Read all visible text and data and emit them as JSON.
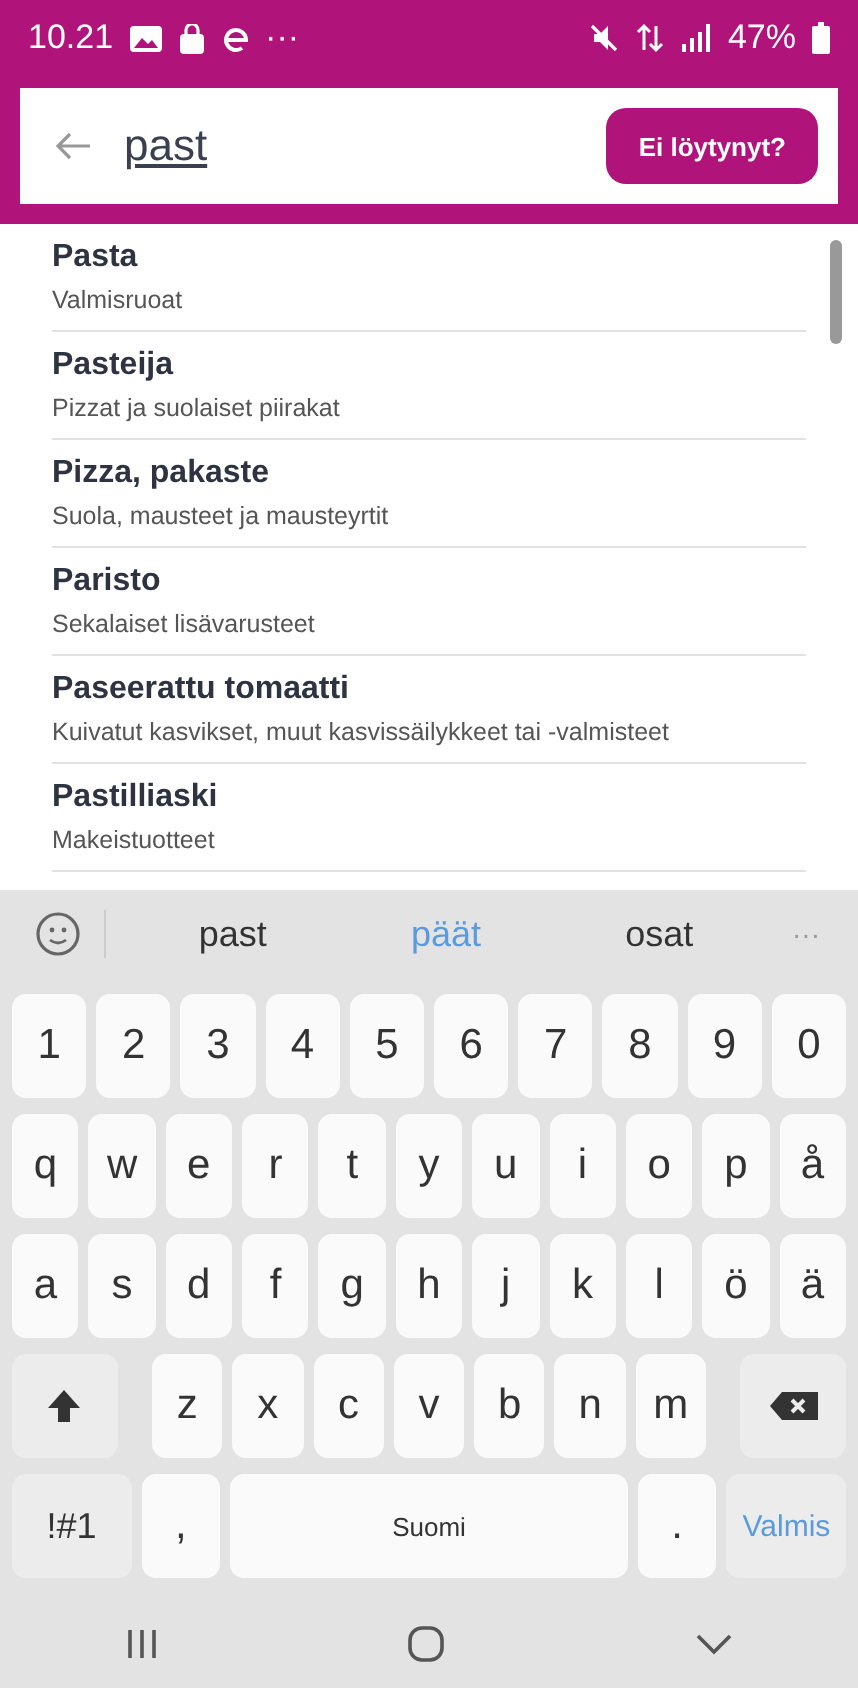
{
  "status_bar": {
    "time": "10.21",
    "more": "···",
    "battery": "47%"
  },
  "search": {
    "value": "past",
    "not_found_button": "Ei löytynyt?"
  },
  "results": [
    {
      "name": "Pasta",
      "category": "Valmisruoat"
    },
    {
      "name": "Pasteija",
      "category": "Pizzat ja suolaiset piirakat"
    },
    {
      "name": "Pizza, pakaste",
      "category": "Suola, mausteet ja mausteyrtit"
    },
    {
      "name": "Paristo",
      "category": "Sekalaiset lisävarusteet"
    },
    {
      "name": "Paseerattu tomaatti",
      "category": "Kuivatut kasvikset, muut kasvissäilykkeet tai -valmisteet"
    },
    {
      "name": "Pastilliaski",
      "category": "Makeistuotteet"
    }
  ],
  "keyboard": {
    "suggestions": [
      {
        "label": "past",
        "selected": false
      },
      {
        "label": "päät",
        "selected": true
      },
      {
        "label": "osat",
        "selected": false
      }
    ],
    "more": "···",
    "number_keys": [
      {
        "kind": "char",
        "label": "1"
      },
      {
        "kind": "char",
        "label": "2"
      },
      {
        "kind": "char",
        "label": "3"
      },
      {
        "kind": "char",
        "label": "4"
      },
      {
        "kind": "char",
        "label": "5"
      },
      {
        "kind": "char",
        "label": "6"
      },
      {
        "kind": "char",
        "label": "7"
      },
      {
        "kind": "char",
        "label": "8"
      },
      {
        "kind": "char",
        "label": "9"
      },
      {
        "kind": "char",
        "label": "0"
      }
    ],
    "top_letter_keys": [
      {
        "kind": "char",
        "label": "q"
      },
      {
        "kind": "char",
        "label": "w"
      },
      {
        "kind": "char",
        "label": "e"
      },
      {
        "kind": "char",
        "label": "r"
      },
      {
        "kind": "char",
        "label": "t"
      },
      {
        "kind": "char",
        "label": "y"
      },
      {
        "kind": "char",
        "label": "u"
      },
      {
        "kind": "char",
        "label": "i"
      },
      {
        "kind": "char",
        "label": "o"
      },
      {
        "kind": "char",
        "label": "p"
      },
      {
        "kind": "char",
        "label": "å"
      }
    ],
    "middle_letter_keys": [
      {
        "kind": "char",
        "label": "a"
      },
      {
        "kind": "char",
        "label": "s"
      },
      {
        "kind": "char",
        "label": "d"
      },
      {
        "kind": "char",
        "label": "f"
      },
      {
        "kind": "char",
        "label": "g"
      },
      {
        "kind": "char",
        "label": "h"
      },
      {
        "kind": "char",
        "label": "j"
      },
      {
        "kind": "char",
        "label": "k"
      },
      {
        "kind": "char",
        "label": "l"
      },
      {
        "kind": "char",
        "label": "ö"
      },
      {
        "kind": "char",
        "label": "ä"
      }
    ],
    "bottom_letter_keys": [
      {
        "kind": "shift"
      },
      {
        "kind": "char",
        "label": "z"
      },
      {
        "kind": "char",
        "label": "x"
      },
      {
        "kind": "char",
        "label": "c"
      },
      {
        "kind": "char",
        "label": "v"
      },
      {
        "kind": "char",
        "label": "b"
      },
      {
        "kind": "char",
        "label": "n"
      },
      {
        "kind": "char",
        "label": "m"
      },
      {
        "kind": "backspace"
      }
    ],
    "function_keys": [
      {
        "kind": "symbols",
        "label": "!#1"
      },
      {
        "kind": "char",
        "label": ","
      },
      {
        "kind": "space",
        "label": "Suomi"
      },
      {
        "kind": "char",
        "label": "."
      },
      {
        "kind": "action",
        "label": "Valmis"
      }
    ]
  }
}
